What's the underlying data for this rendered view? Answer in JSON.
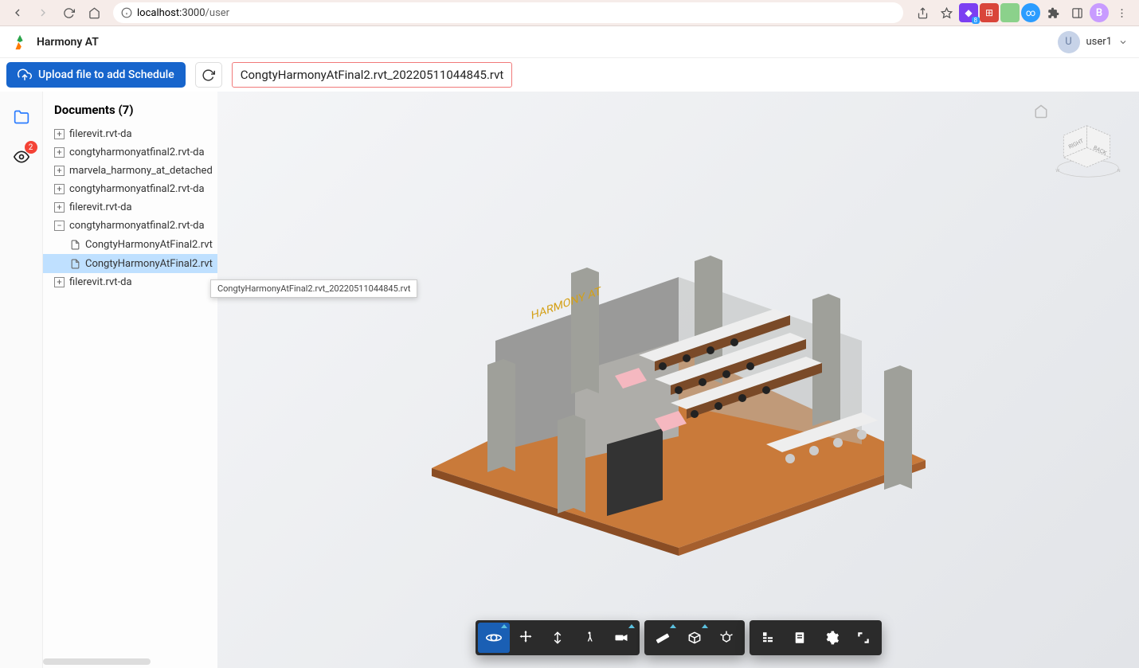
{
  "browser": {
    "url_host": "localhost:",
    "url_port": "3000",
    "url_path": "/user",
    "avatar_letter": "B",
    "ext_purple_badge": "8"
  },
  "app": {
    "brand": "Harmony AT",
    "user_avatar": "U",
    "user_name": "user1"
  },
  "toolbar": {
    "upload_label": "Upload file to add Schedule",
    "file_title": "CongtyHarmonyAtFinal2.rvt_20220511044845.rvt"
  },
  "panel": {
    "title": "Documents (7)",
    "items": [
      {
        "label": "filerevit.rvt-da",
        "expanded": false
      },
      {
        "label": "congtyharmonyatfinal2.rvt-da",
        "expanded": false
      },
      {
        "label": "marvela_harmony_at_detached",
        "expanded": false
      },
      {
        "label": "congtyharmonyatfinal2.rvt-da",
        "expanded": false
      },
      {
        "label": "filerevit.rvt-da",
        "expanded": false
      },
      {
        "label": "congtyharmonyatfinal2.rvt-da",
        "expanded": true,
        "children": [
          {
            "label": "CongtyHarmonyAtFinal2.rvt",
            "selected": false
          },
          {
            "label": "CongtyHarmonyAtFinal2.rvt",
            "selected": true
          }
        ]
      },
      {
        "label": "filerevit.rvt-da",
        "expanded": false
      }
    ],
    "tooltip": "CongtyHarmonyAtFinal2.rvt_20220511044845.rvt"
  },
  "rail": {
    "badge_count": "2"
  },
  "viewcube": {
    "face_right": "RIGHT",
    "face_back": "BACK"
  }
}
